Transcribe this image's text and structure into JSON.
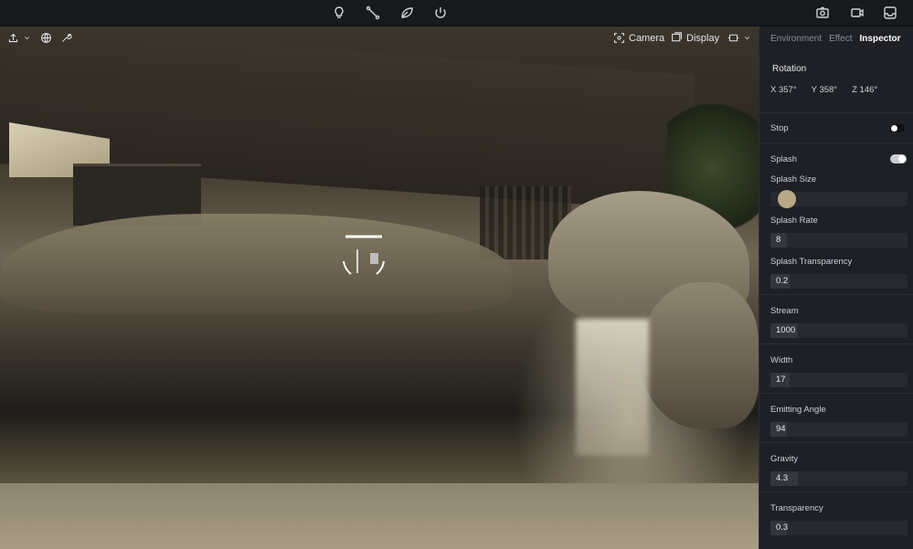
{
  "toolbar": {
    "icons": [
      "lightbulb-icon",
      "path-icon",
      "leaf-icon",
      "power-icon"
    ],
    "right_icons": [
      "camera-icon",
      "video-icon",
      "inbox-icon"
    ]
  },
  "viewport": {
    "camera_label": "Camera",
    "display_label": "Display"
  },
  "panel": {
    "tabs": [
      {
        "label": "Environment",
        "active": false
      },
      {
        "label": "Effect",
        "active": false
      },
      {
        "label": "Inspector",
        "active": true
      }
    ],
    "rotation": {
      "title": "Rotation",
      "x": "X 357°",
      "y": "Y 358°",
      "z": "Z 146°"
    },
    "stop": {
      "label": "Stop",
      "on": false
    },
    "splash": {
      "label": "Splash",
      "on": true
    },
    "splash_size": {
      "label": "Splash Size",
      "value_fraction": 0.08
    },
    "fields": [
      {
        "label": "Splash Rate",
        "value": "8",
        "fill": 0.12
      },
      {
        "label": "Splash Transparency",
        "value": "0.2",
        "fill": 0.14
      },
      {
        "label": "Stream",
        "value": "1000",
        "fill": 0.2
      },
      {
        "label": "Width",
        "value": "17",
        "fill": 0.14
      },
      {
        "label": "Emitting Angle",
        "value": "94",
        "fill": 0.12
      },
      {
        "label": "Gravity",
        "value": "4.3",
        "fill": 0.2
      },
      {
        "label": "Transparency",
        "value": "0.3",
        "fill": 0.12
      }
    ]
  }
}
